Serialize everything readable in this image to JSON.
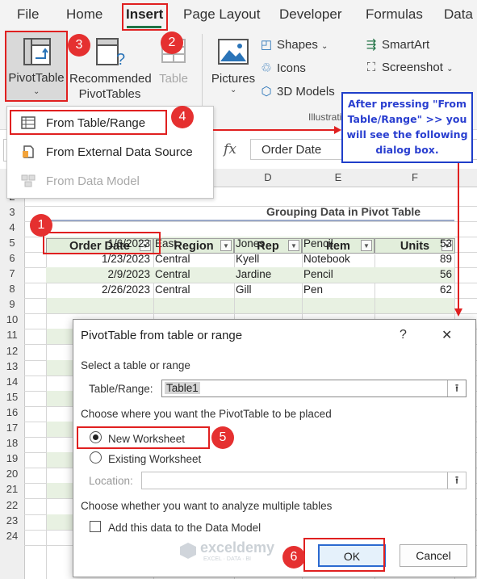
{
  "ribbon_tabs": [
    "File",
    "Home",
    "Insert",
    "Page Layout",
    "Developer",
    "Formulas",
    "Data"
  ],
  "ribbon": {
    "pivot_table": "PivotTable",
    "recommended_line1": "Recommended",
    "recommended_line2": "PivotTables",
    "table": "Table",
    "pictures": "Pictures",
    "shapes": "Shapes",
    "icons": "Icons",
    "models_3d": "3D Models",
    "smartart": "SmartArt",
    "screenshot": "Screenshot",
    "illustrations_partial": "Illustrati"
  },
  "pivot_menu": {
    "items": [
      "From Table/Range",
      "From External Data Source",
      "From Data Model"
    ]
  },
  "formula_bar": {
    "fx": "fx",
    "value": "Order Date"
  },
  "grid": {
    "columns": [
      "D",
      "E",
      "F"
    ],
    "row_numbers": [
      "2",
      "3",
      "4",
      "5",
      "6",
      "7",
      "8",
      "9",
      "10",
      "11",
      "12",
      "13",
      "14",
      "15",
      "16",
      "17",
      "18",
      "19",
      "20",
      "21",
      "22",
      "23",
      "24"
    ],
    "title": "Grouping Data in Pivot Table",
    "headers": [
      "Order Date",
      "Region",
      "Rep",
      "Item",
      "Units"
    ],
    "rows": [
      [
        "1/6/2023",
        "East",
        "Jones",
        "Pencil",
        "53"
      ],
      [
        "1/23/2023",
        "Central",
        "Kyell",
        "Notebook",
        "89"
      ],
      [
        "2/9/2023",
        "Central",
        "Jardine",
        "Pencil",
        "56"
      ],
      [
        "2/26/2023",
        "Central",
        "Gill",
        "Pen",
        "62"
      ]
    ]
  },
  "callout": {
    "text": "After pressing \"From Table/Range\" >> you will see the following dialog box."
  },
  "badges": [
    "1",
    "2",
    "3",
    "4",
    "5",
    "6"
  ],
  "dialog": {
    "title": "PivotTable from table or range",
    "help": "?",
    "close": "✕",
    "select_label": "Select a table or range",
    "table_range_label": "Table/Range:",
    "table_range_value": "Table1",
    "choose_place_label": "Choose where you want the PivotTable to be placed",
    "new_worksheet": "New Worksheet",
    "existing_worksheet": "Existing Worksheet",
    "location_label": "Location:",
    "analyze_label": "Choose whether you want to analyze multiple tables",
    "add_data_model": "Add this data to the Data Model",
    "ok": "OK",
    "cancel": "Cancel",
    "upload_glyph": "⭱"
  },
  "watermark": {
    "name": "exceldemy",
    "tagline": "EXCEL · DATA · BI"
  }
}
